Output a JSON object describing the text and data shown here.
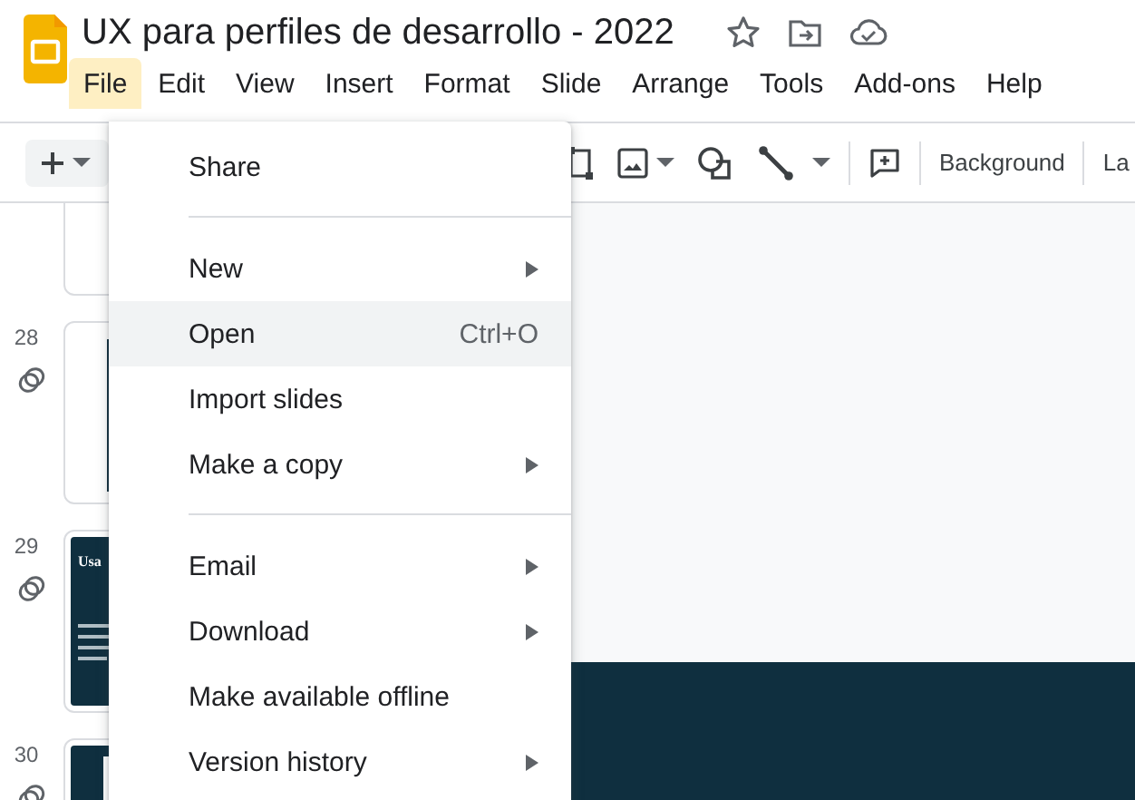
{
  "document": {
    "title": "UX para perfiles de desarrollo - 2022"
  },
  "menu_bar": [
    {
      "label": "File",
      "selected": true
    },
    {
      "label": "Edit",
      "selected": false
    },
    {
      "label": "View",
      "selected": false
    },
    {
      "label": "Insert",
      "selected": false
    },
    {
      "label": "Format",
      "selected": false
    },
    {
      "label": "Slide",
      "selected": false
    },
    {
      "label": "Arrange",
      "selected": false
    },
    {
      "label": "Tools",
      "selected": false
    },
    {
      "label": "Add-ons",
      "selected": false
    },
    {
      "label": "Help",
      "selected": false
    }
  ],
  "toolbar": {
    "buttons": [
      "Background",
      "La"
    ]
  },
  "filmstrip": [
    {
      "dark": false,
      "linked": false
    },
    {
      "number": "28",
      "dark": false,
      "linked": true
    },
    {
      "number": "29",
      "dark": true,
      "linked": true,
      "title": "Usa"
    },
    {
      "number": "30",
      "dark": true,
      "linked": true
    }
  ],
  "file_menu": [
    {
      "kind": "item",
      "label": "Share",
      "submenu": false,
      "selected": false
    },
    {
      "kind": "divider"
    },
    {
      "kind": "item",
      "label": "New",
      "submenu": true,
      "selected": false
    },
    {
      "kind": "item",
      "label": "Open",
      "shortcut": "Ctrl+O",
      "submenu": false,
      "selected": true
    },
    {
      "kind": "item",
      "label": "Import slides",
      "submenu": false,
      "selected": false
    },
    {
      "kind": "item",
      "label": "Make a copy",
      "submenu": true,
      "selected": false
    },
    {
      "kind": "divider"
    },
    {
      "kind": "item",
      "label": "Email",
      "submenu": true,
      "selected": false
    },
    {
      "kind": "item",
      "label": "Download",
      "submenu": true,
      "selected": false
    },
    {
      "kind": "item",
      "label": "Make available offline",
      "submenu": false,
      "selected": false
    },
    {
      "kind": "item",
      "label": "Version history",
      "submenu": true,
      "selected": false
    }
  ]
}
